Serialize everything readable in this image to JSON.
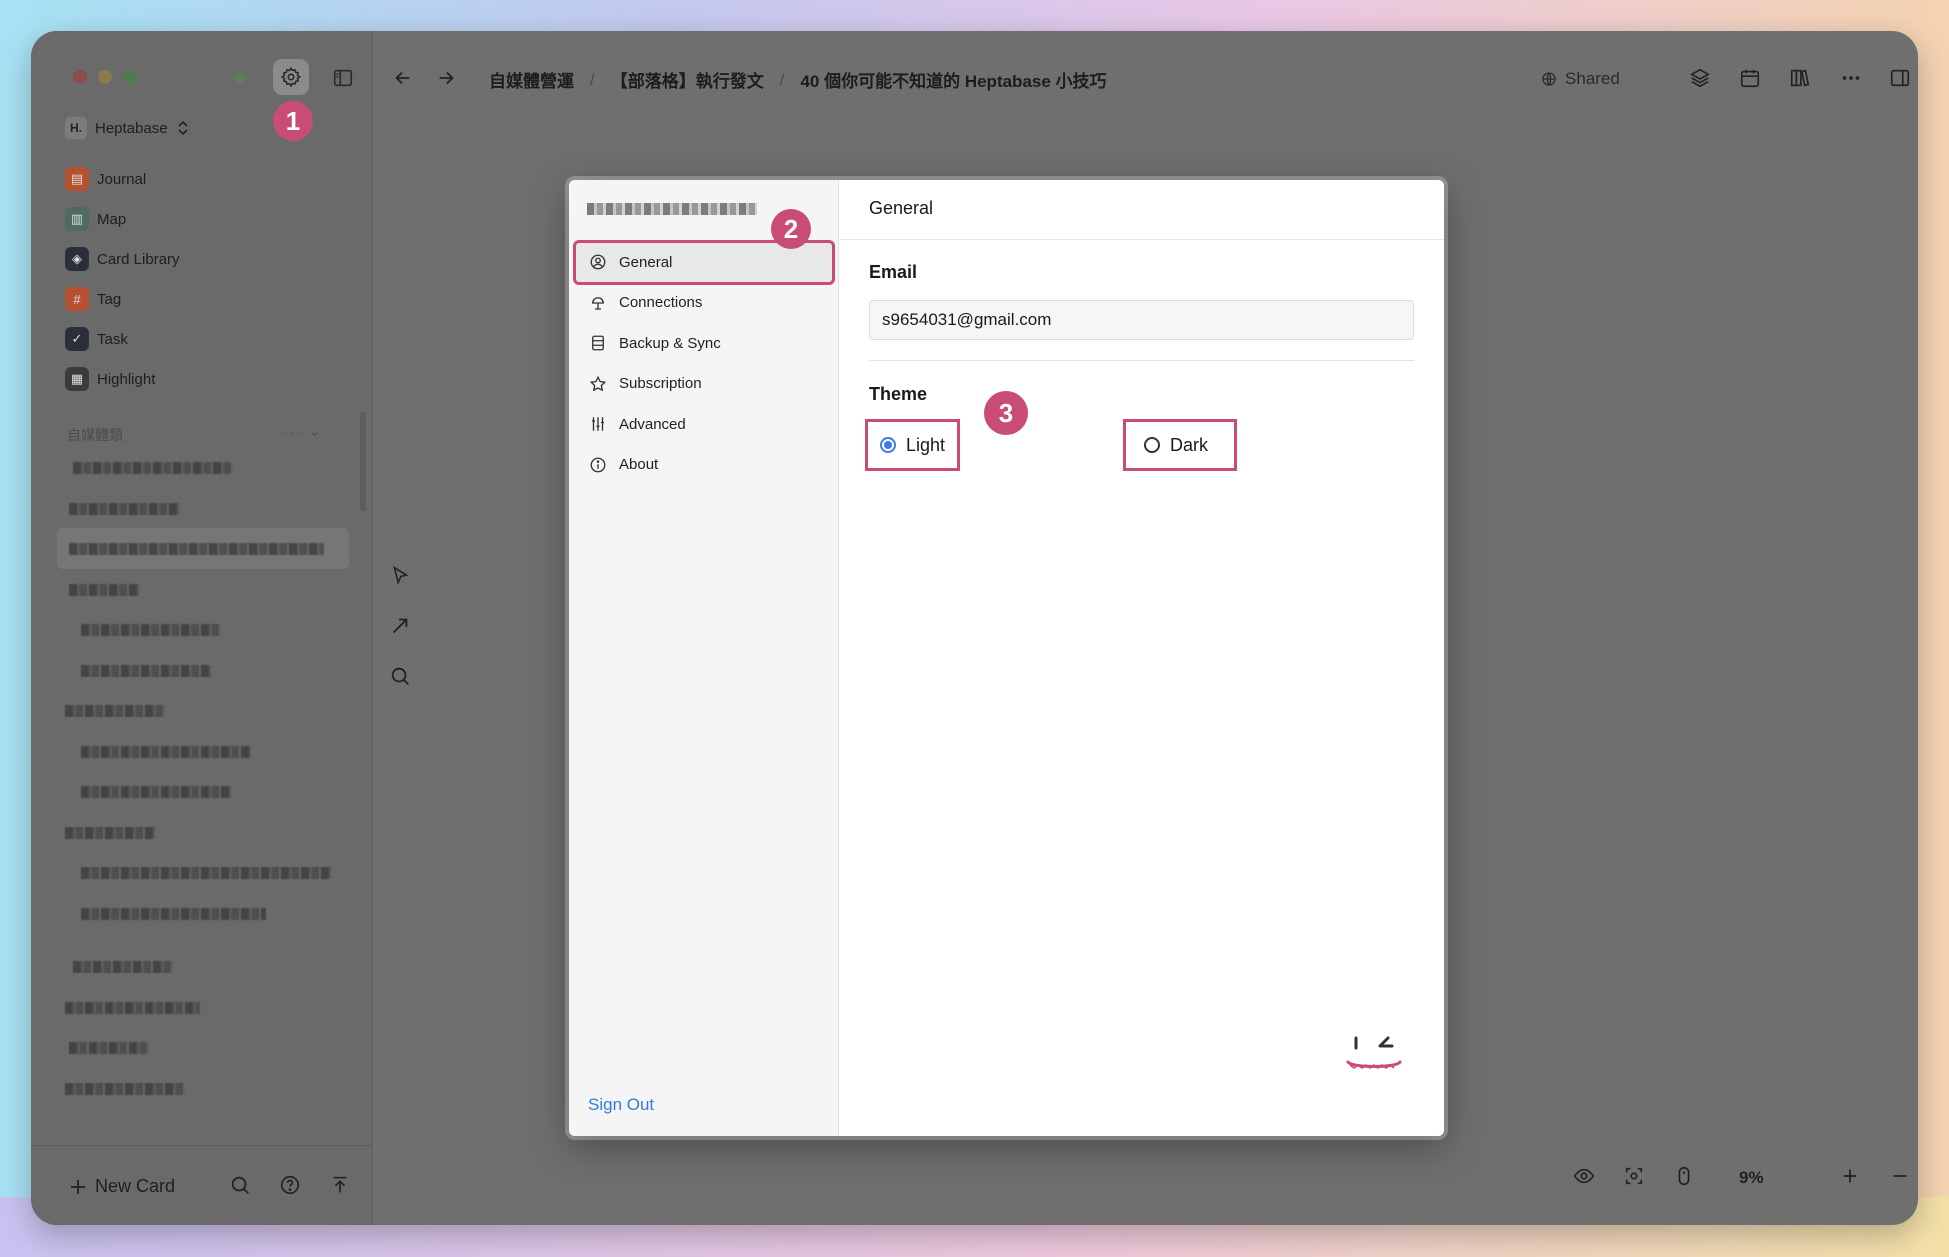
{
  "window": {
    "breadcrumb": [
      "自媒體營運",
      "【部落格】執行發文",
      "40 個你可能不知道的 Heptabase 小技巧"
    ],
    "shared_label": "Shared",
    "zoom": "9%"
  },
  "sidebar": {
    "workspace": "Heptabase",
    "workspace_logo": "H.",
    "nav": [
      {
        "label": "Journal",
        "icon": "journal-icon",
        "color": "#c3532e"
      },
      {
        "label": "Map",
        "icon": "map-icon",
        "color": "#4f6a5f"
      },
      {
        "label": "Card Library",
        "icon": "card-library-icon",
        "color": "#2a2f3a"
      },
      {
        "label": "Tag",
        "icon": "tag-icon",
        "color": "#c3532e"
      },
      {
        "label": "Task",
        "icon": "task-icon",
        "color": "#2a2f3a"
      },
      {
        "label": "Highlight",
        "icon": "highlight-icon",
        "color": "#3b3b3b"
      }
    ],
    "section_title": "自媒體類",
    "new_card_label": "New Card"
  },
  "callouts": {
    "one": "1",
    "two": "2",
    "three": "3"
  },
  "settings": {
    "menu": [
      {
        "label": "General",
        "icon": "user-circle-icon"
      },
      {
        "label": "Connections",
        "icon": "connections-icon"
      },
      {
        "label": "Backup & Sync",
        "icon": "database-icon"
      },
      {
        "label": "Subscription",
        "icon": "star-icon"
      },
      {
        "label": "Advanced",
        "icon": "sliders-icon"
      },
      {
        "label": "About",
        "icon": "info-icon"
      }
    ],
    "sign_out": "Sign Out",
    "panel_title": "General",
    "email_label": "Email",
    "email_value": "s9654031@gmail.com",
    "theme_label": "Theme",
    "theme_options": [
      "Light",
      "Dark"
    ],
    "theme_selected": "Light",
    "accent_color": "#c94c78"
  }
}
